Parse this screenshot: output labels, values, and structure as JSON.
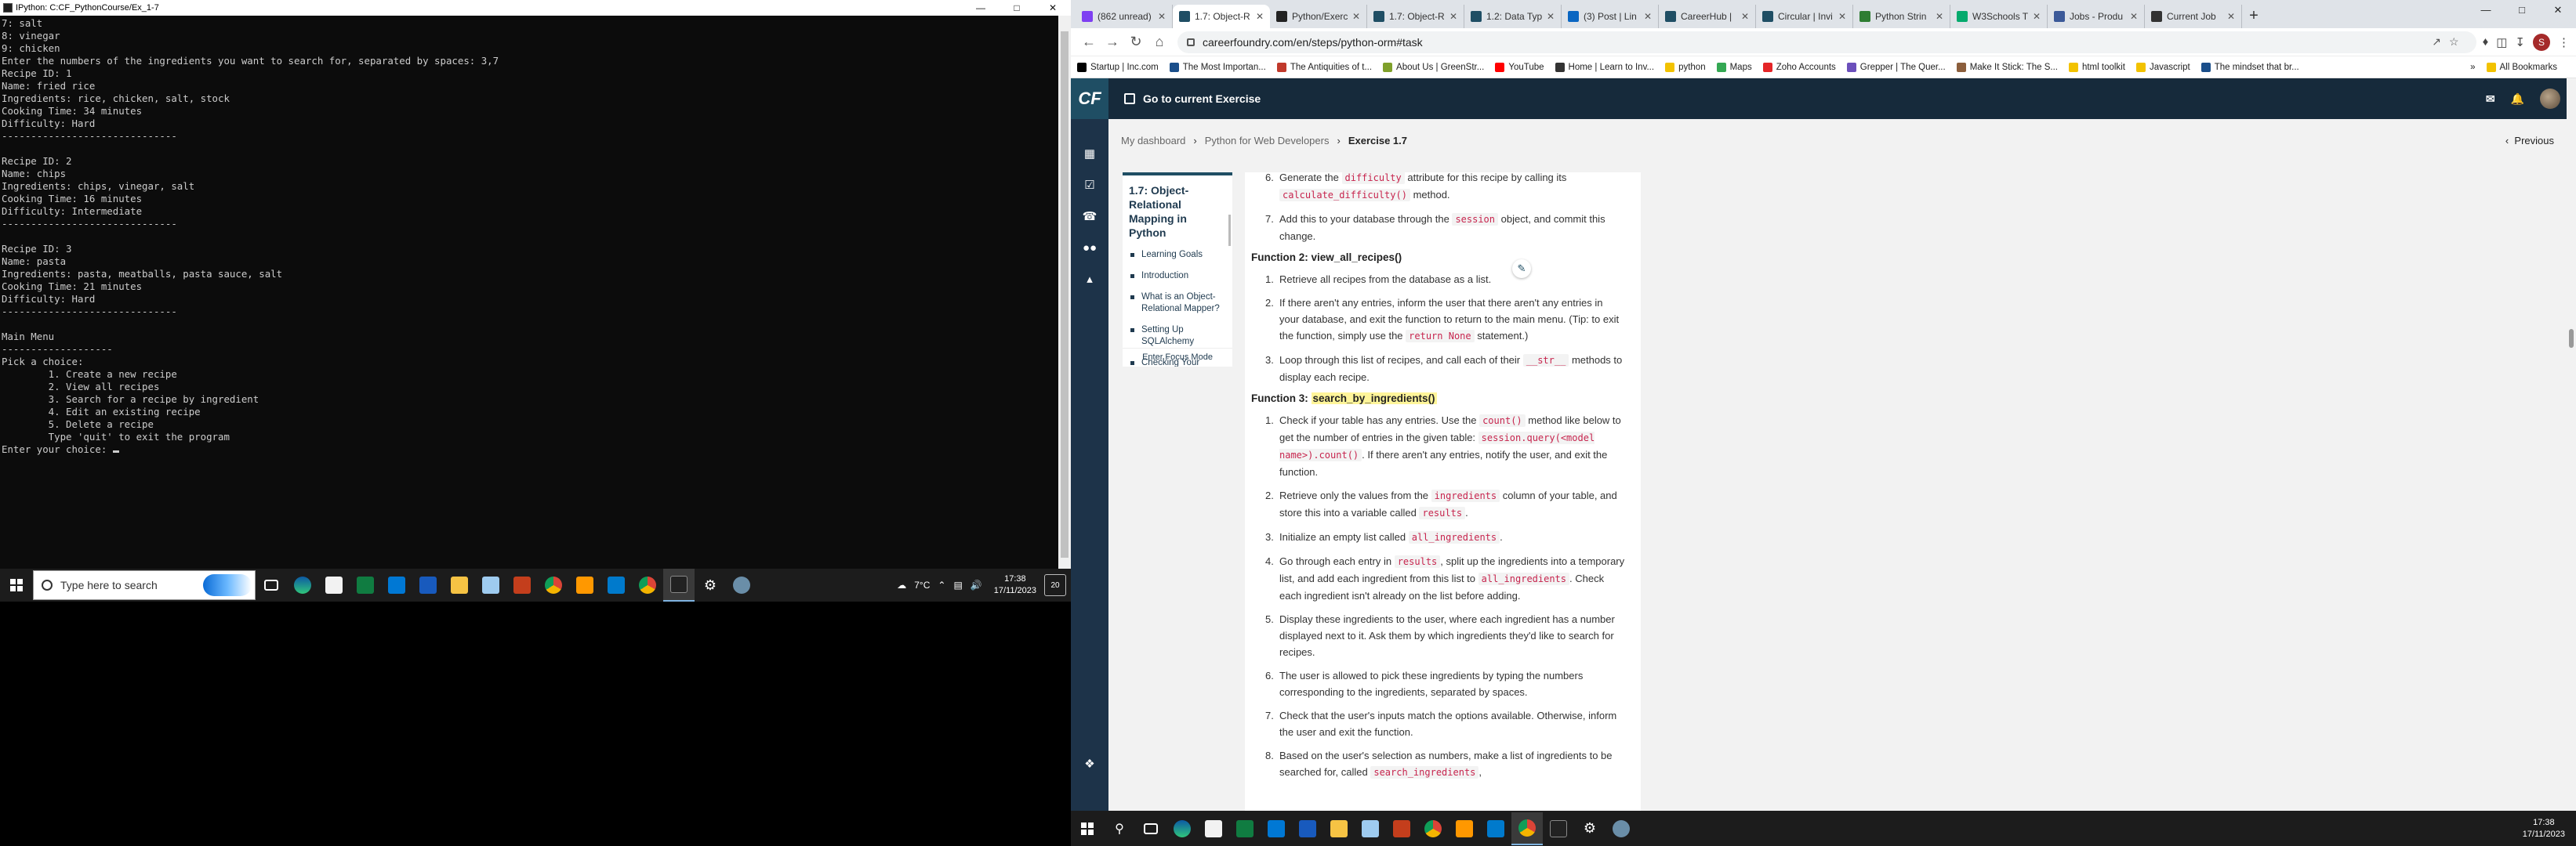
{
  "console": {
    "title": "IPython: C:CF_PythonCourse/Ex_1-7",
    "lines": [
      "7: salt",
      "8: vinegar",
      "9: chicken",
      "Enter the numbers of the ingredients you want to search for, separated by spaces: 3,7",
      "Recipe ID: 1",
      "Name: fried rice",
      "Ingredients: rice, chicken, salt, stock",
      "Cooking Time: 34 minutes",
      "Difficulty: Hard",
      "------------------------------",
      "",
      "Recipe ID: 2",
      "Name: chips",
      "Ingredients: chips, vinegar, salt",
      "Cooking Time: 16 minutes",
      "Difficulty: Intermediate",
      "------------------------------",
      "",
      "Recipe ID: 3",
      "Name: pasta",
      "Ingredients: pasta, meatballs, pasta sauce, salt",
      "Cooking Time: 21 minutes",
      "Difficulty: Hard",
      "------------------------------",
      "",
      "Main Menu",
      "-------------------",
      "Pick a choice:",
      "        1. Create a new recipe",
      "        2. View all recipes",
      "        3. Search for a recipe by ingredient",
      "        4. Edit an existing recipe",
      "        5. Delete a recipe",
      "        Type 'quit' to exit the program"
    ],
    "prompt": "Enter your choice: "
  },
  "left_taskbar": {
    "search_placeholder": "Type here to search",
    "weather": "7°C",
    "time": "17:38",
    "date": "17/11/2023",
    "notifications": "20"
  },
  "browser": {
    "tabs": [
      {
        "label": "(862 unread)",
        "color": "#7e3ff2"
      },
      {
        "label": "1.7: Object-R",
        "color": "#1f4e64",
        "active": true
      },
      {
        "label": "Python/Exerc",
        "color": "#222222"
      },
      {
        "label": "1.7: Object-R",
        "color": "#1f4e64"
      },
      {
        "label": "1.2: Data Typ",
        "color": "#1f4e64"
      },
      {
        "label": "(3) Post | Lin",
        "color": "#0a66c2"
      },
      {
        "label": "CareerHub |",
        "color": "#1f4e64"
      },
      {
        "label": "Circular | Invi",
        "color": "#1f4e64"
      },
      {
        "label": "Python Strin",
        "color": "#2e7d32"
      },
      {
        "label": "W3Schools T",
        "color": "#04aa6d"
      },
      {
        "label": "Jobs - Produ",
        "color": "#3b5998"
      },
      {
        "label": "Current Job",
        "color": "#333333"
      }
    ],
    "url": "careerfoundry.com/en/steps/python-orm#task",
    "bookmarks": [
      {
        "label": "Startup | Inc.com",
        "color": "#000000"
      },
      {
        "label": "The Most Importan...",
        "color": "#1a4e8a"
      },
      {
        "label": "The Antiquities of t...",
        "color": "#c0392b"
      },
      {
        "label": "About Us | GreenStr...",
        "color": "#7fa02b"
      },
      {
        "label": "YouTube",
        "color": "#ff0000"
      },
      {
        "label": "Home | Learn to Inv...",
        "color": "#333333"
      },
      {
        "label": "python",
        "color": "#f2c200"
      },
      {
        "label": "Maps",
        "color": "#34a853"
      },
      {
        "label": "Zoho Accounts",
        "color": "#e42527"
      },
      {
        "label": "Grepper | The Quer...",
        "color": "#6b4fbb"
      },
      {
        "label": "Make It Stick: The S...",
        "color": "#8b5e3c"
      },
      {
        "label": "html toolkit",
        "color": "#f2c200"
      },
      {
        "label": "Javascript",
        "color": "#f2c200"
      },
      {
        "label": "The mindset that br...",
        "color": "#1a4e8a"
      }
    ],
    "all_bookmarks": "All Bookmarks",
    "profile_initial": "S"
  },
  "cf": {
    "logo": "CF",
    "header_title": "Go to current Exercise",
    "breadcrumb": [
      "My dashboard",
      "Python for Web Developers",
      "Exercise 1.7"
    ],
    "previous": "Previous",
    "toc_title": "1.7: Object-Relational Mapping in Python",
    "toc_items": [
      "Learning Goals",
      "Introduction",
      "What is an Object-Relational Mapper?",
      "Setting Up SQLAlchemy",
      "Checking Your MySQL Server is Running"
    ],
    "focus_mode": "Enter Focus Mode",
    "content": {
      "item6_num": "6.",
      "item6_a": "Generate the ",
      "item6_code1": "difficulty",
      "item6_b": " attribute for this recipe by calling its ",
      "item6_code2": "calculate_difficulty()",
      "item6_c": " method.",
      "item7_num": "7.",
      "item7_a": "Add this to your database through the ",
      "item7_code": "session",
      "item7_b": " object, and commit this change.",
      "f2_title": "Function 2: view_all_recipes()",
      "f2": [
        {
          "num": "1.",
          "a": "Retrieve all recipes from the database as a list."
        },
        {
          "num": "2.",
          "a": "If there aren't any entries, inform the user that there aren't any entries in your database, and exit the function to return to the main menu. (Tip: to exit the function, simply use the ",
          "code": "return None",
          "b": " statement.)"
        },
        {
          "num": "3.",
          "a": "Loop through this list of recipes, and call each of their ",
          "code": "__str__",
          "b": " methods to display each recipe."
        }
      ],
      "f3_prefix": "Function 3: ",
      "f3_hl": "search_by_ingredients()",
      "f3_1_num": "1.",
      "f3_1_a": "Check if your table has any entries. Use the ",
      "f3_1_code1": "count()",
      "f3_1_b": " method like below to get the number of entries in the given table: ",
      "f3_1_code2": "session.query(<model name>).count()",
      "f3_1_c": ". If there aren't any entries, notify the user, and exit the function.",
      "f3_2_num": "2.",
      "f3_2_a": "Retrieve only the values from the ",
      "f3_2_code1": "ingredients",
      "f3_2_b": " column of your table, and store this into a variable called ",
      "f3_2_code2": "results",
      "f3_2_c": ".",
      "f3_3_num": "3.",
      "f3_3_a": "Initialize an empty list called ",
      "f3_3_code": "all_ingredients",
      "f3_3_b": ".",
      "f3_4_num": "4.",
      "f3_4_a": "Go through each entry in ",
      "f3_4_code1": "results",
      "f3_4_b": ", split up the ingredients into a temporary list, and add each ingredient from this list to ",
      "f3_4_code2": "all_ingredients",
      "f3_4_c": ". Check each ingredient isn't already on the list before adding.",
      "f3_5_num": "5.",
      "f3_5": "Display these ingredients to the user, where each ingredient has a number displayed next to it. Ask them by which ingredients they'd like to search for recipes.",
      "f3_6_num": "6.",
      "f3_6": "The user is allowed to pick these ingredients by typing the numbers corresponding to the ingredients, separated by spaces.",
      "f3_7_num": "7.",
      "f3_7": "Check that the user's inputs match the options available. Otherwise, inform the user and exit the function.",
      "f3_8_num": "8.",
      "f3_8_a": "Based on the user's selection as numbers, make a list of ingredients to be searched for, called ",
      "f3_8_code": "search_ingredients",
      "f3_8_b": ","
    }
  },
  "right_taskbar": {
    "time": "17:38",
    "date": "17/11/2023"
  }
}
